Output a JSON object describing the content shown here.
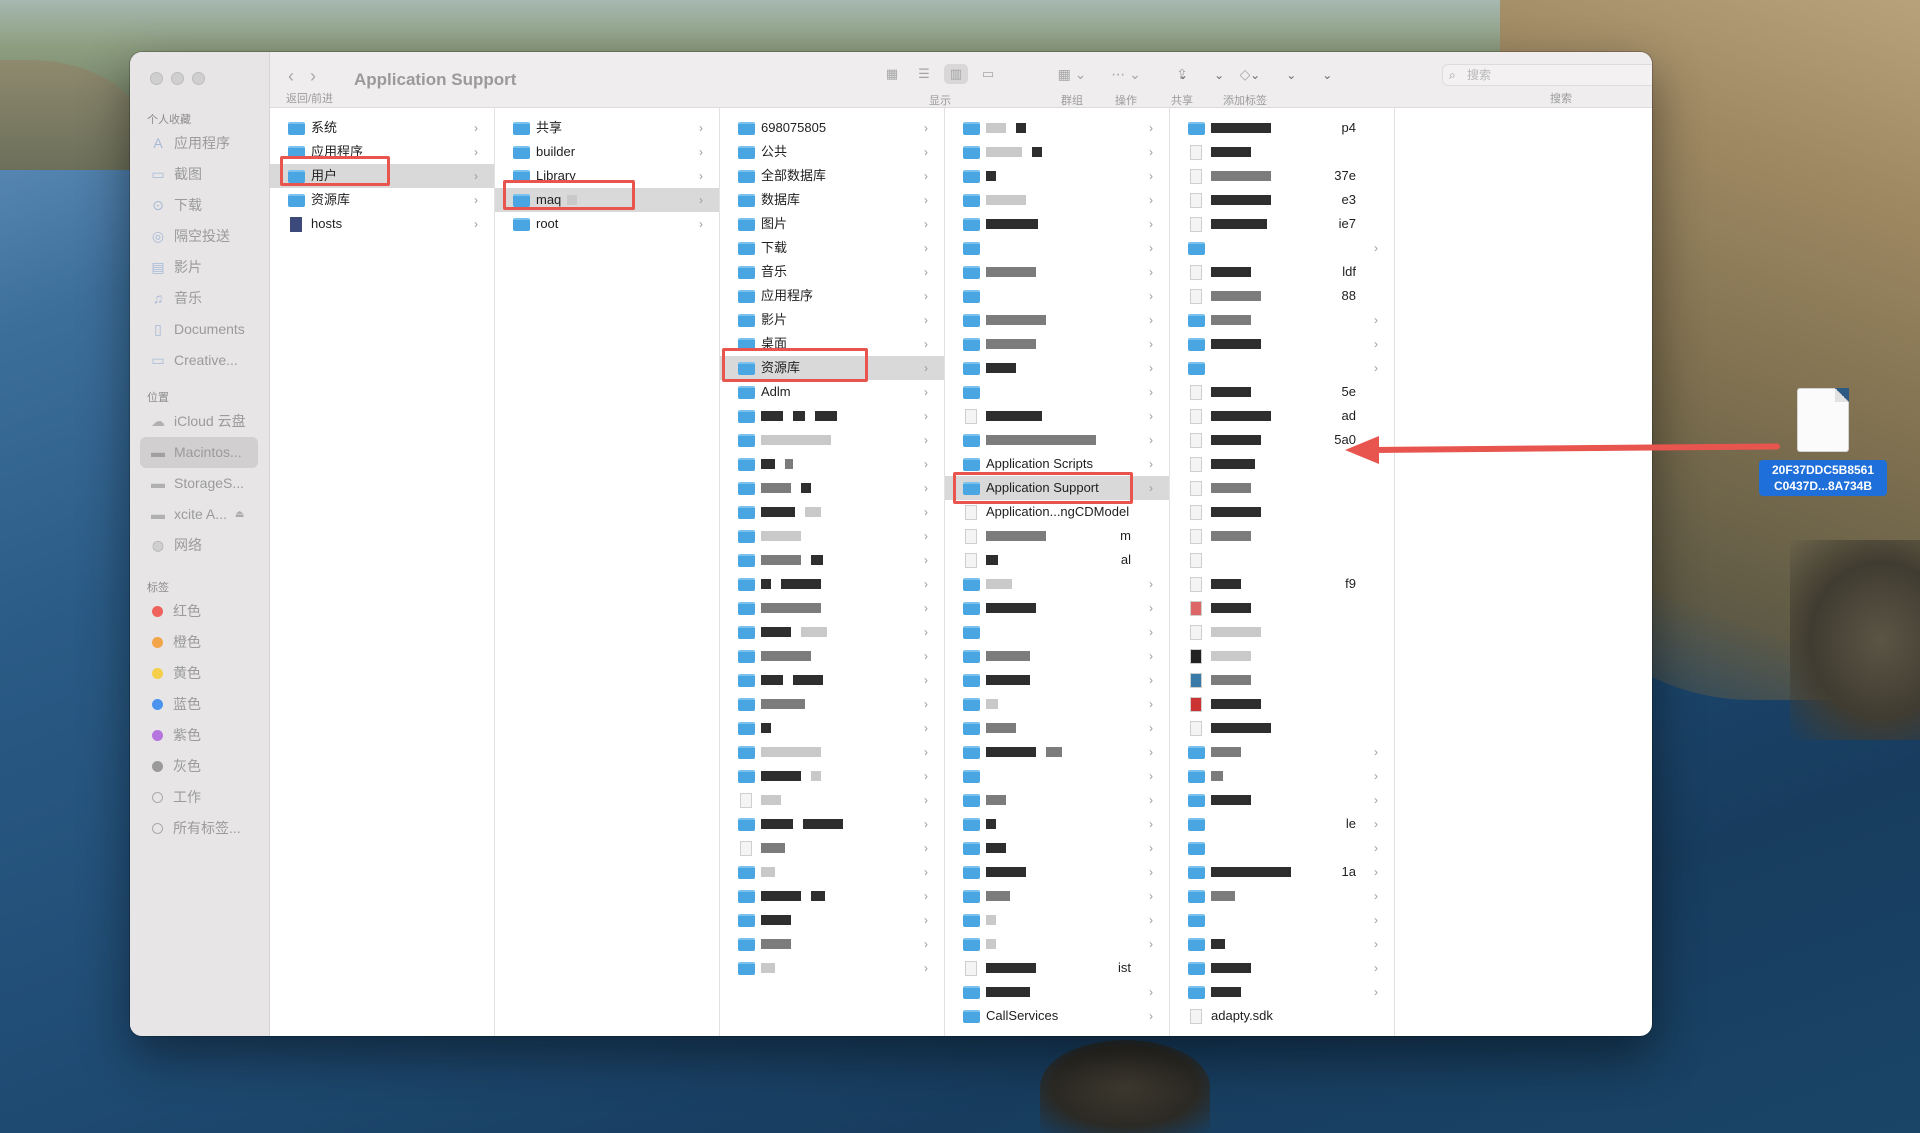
{
  "window": {
    "title": "Application Support",
    "nav_label": "返回/前进",
    "toolbar": {
      "view_label": "显示",
      "group_label": "群组",
      "action_label": "操作",
      "share_label": "共享",
      "tag_label": "添加标签",
      "search_placeholder": "搜索",
      "search_label": "搜索"
    }
  },
  "sidebar": {
    "favorites_header": "个人收藏",
    "favorites": [
      "应用程序",
      "截图",
      "下载",
      "隔空投送",
      "影片",
      "音乐",
      "Documents",
      "Creative..."
    ],
    "locations_header": "位置",
    "locations": [
      "iCloud 云盘",
      "Macintos...",
      "StorageS...",
      "xcite A...",
      "网络"
    ],
    "tags_header": "标签",
    "tags": [
      {
        "label": "红色",
        "color": "#f0625d"
      },
      {
        "label": "橙色",
        "color": "#f3a54a"
      },
      {
        "label": "黄色",
        "color": "#f5cf4a"
      },
      {
        "label": "蓝色",
        "color": "#4a94f0"
      },
      {
        "label": "紫色",
        "color": "#b574de"
      },
      {
        "label": "灰色",
        "color": "#9a9a9a"
      },
      {
        "label": "工作",
        "color": "#ffffff"
      },
      {
        "label": "所有标签...",
        "color": "#ffffff"
      }
    ]
  },
  "columns": {
    "c1": [
      "系统",
      "应用程序",
      "用户",
      "资源库",
      "hosts"
    ],
    "c2": [
      "共享",
      "builder",
      "Library",
      "maq",
      "root"
    ],
    "c3": [
      "698075805",
      "公共",
      "全部数据库",
      "数据库",
      "图片",
      "下载",
      "音乐",
      "应用程序",
      "影片",
      "桌面",
      "资源库",
      "Adlm"
    ],
    "c4": [
      "Application Scripts",
      "Application Support",
      "Application...ngCDModel",
      "CallServices"
    ],
    "c4_tails": [
      "m",
      "al",
      "ist"
    ],
    "c5_tails": [
      "p4",
      "37e",
      "e3",
      "ie7",
      "ldf",
      "88",
      "5e",
      "ad",
      "5a0",
      "f9",
      "le",
      "1a"
    ],
    "c5_last": "adapty.sdk"
  },
  "desktop_file": {
    "line1": "20F37DDC5B8561",
    "line2": "C0437D...8A734B"
  },
  "colors": {
    "highlight": "#e8544e",
    "folder": "#4aa6e3",
    "selection": "#1e6fd9"
  }
}
